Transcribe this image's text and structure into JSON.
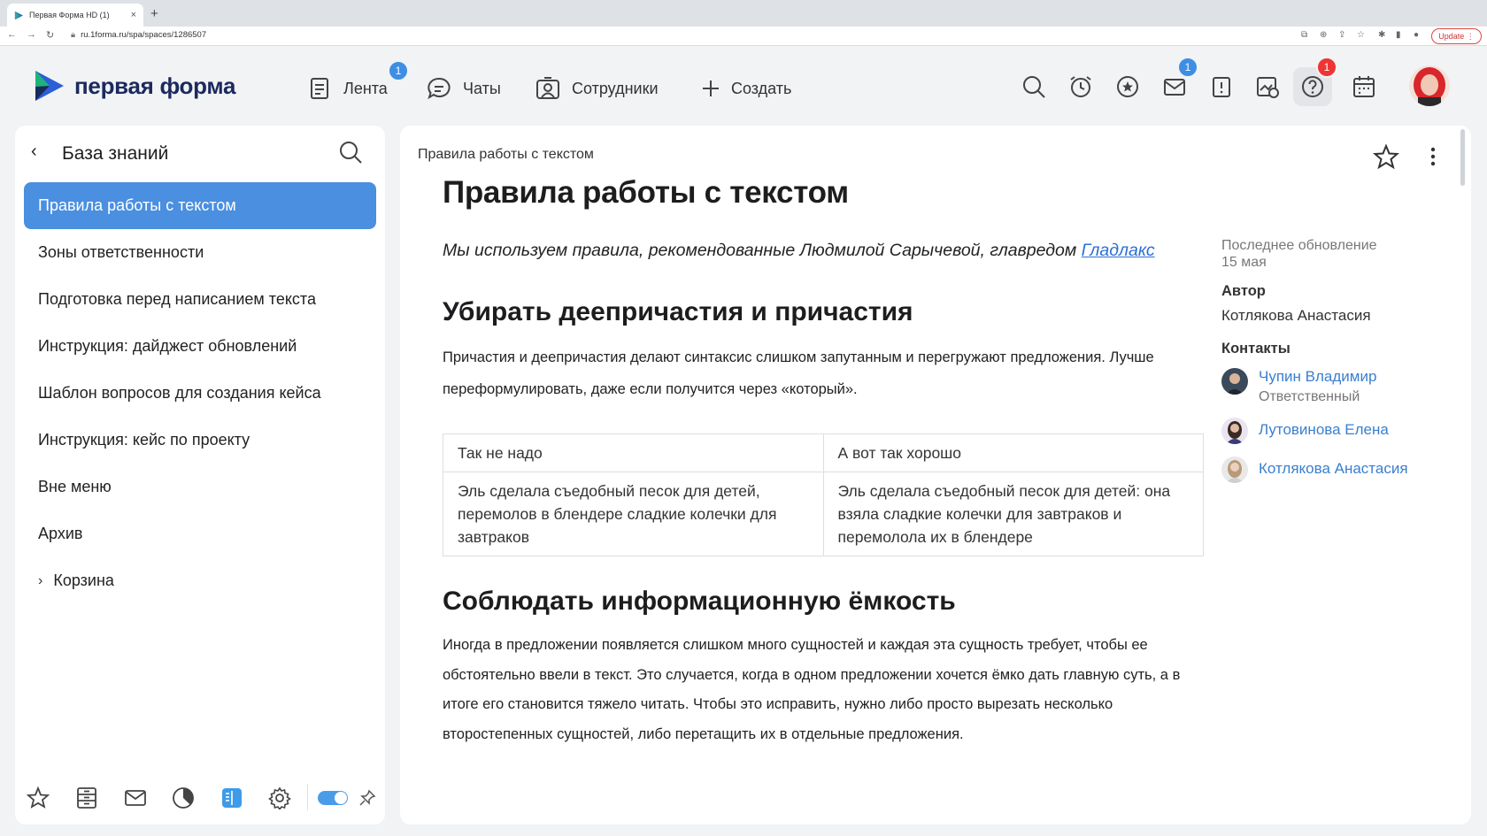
{
  "browser": {
    "tab_title": "Первая Форма HD (1)",
    "tab_close": "×",
    "new_tab": "+",
    "url": "ru.1forma.ru/spa/spaces/1286507",
    "update_label": "Update"
  },
  "header": {
    "logo_text": "первая форма",
    "nav": {
      "feed_label": "Лента",
      "feed_badge": "1",
      "chats_label": "Чаты",
      "employees_label": "Сотрудники",
      "create_label": "Создать"
    },
    "mail_badge": "1",
    "help_badge": "1"
  },
  "left": {
    "title": "База знаний",
    "items": [
      {
        "label": "Правила работы с текстом"
      },
      {
        "label": "Зоны ответственности"
      },
      {
        "label": "Подготовка перед написанием текста"
      },
      {
        "label": "Инструкция: дайджест обновлений"
      },
      {
        "label": "Шаблон вопросов для создания кейса"
      },
      {
        "label": "Инструкция: кейс по проекту"
      },
      {
        "label": "Вне меню"
      },
      {
        "label": "Архив"
      },
      {
        "label": "Корзина"
      }
    ]
  },
  "main": {
    "breadcrumb": "Правила работы с текстом",
    "title": "Правила работы с текстом",
    "lead_text": "Мы используем правила, рекомендованные Людмилой Сарычевой, главредом ",
    "lead_link": "Гладлакс",
    "section1_title": "Убирать деепричастия и причастия",
    "section1_text": "Причастия и деепричастия делают синтаксис слишком запутанным и перегружают предложения. Лучше переформулировать, даже если получится через «который».",
    "table": {
      "headers": [
        "Так не надо",
        "А вот так хорошо"
      ],
      "rows": [
        [
          "Эль сделала съедобный песок для детей, перемолов в блендере сладкие колечки для завтраков",
          "Эль сделала съедобный песок для детей: она взяла сладкие колечки для завтраков и перемолола их в блендере"
        ]
      ]
    },
    "section2_title": "Соблюдать информационную ёмкость",
    "section2_text": "Иногда в предложении появляется слишком много сущностей и каждая эта сущность требует, чтобы ее обстоятельно ввели в текст. Это случается, когда в одном предложении хочется ёмко дать главную суть, а в итоге его становится тяжело читать. Чтобы это исправить, нужно либо просто вырезать несколько второстепенных сущностей, либо перетащить их в отдельные предложения."
  },
  "sidebar": {
    "updated_label": "Последнее обновление",
    "updated_value": "15 мая",
    "author_heading": "Автор",
    "author_name": "Котлякова Анастасия",
    "contacts_heading": "Контакты",
    "contacts": [
      {
        "name": "Чупин Владимир",
        "role": "Ответственный"
      },
      {
        "name": "Лутовинова Елена",
        "role": ""
      },
      {
        "name": "Котлякова Анастасия",
        "role": ""
      }
    ]
  },
  "colors": {
    "accent": "#4a8fe0",
    "badge_blue": "#3e8ee4",
    "badge_red": "#ee3434",
    "link": "#3a7fd0"
  }
}
